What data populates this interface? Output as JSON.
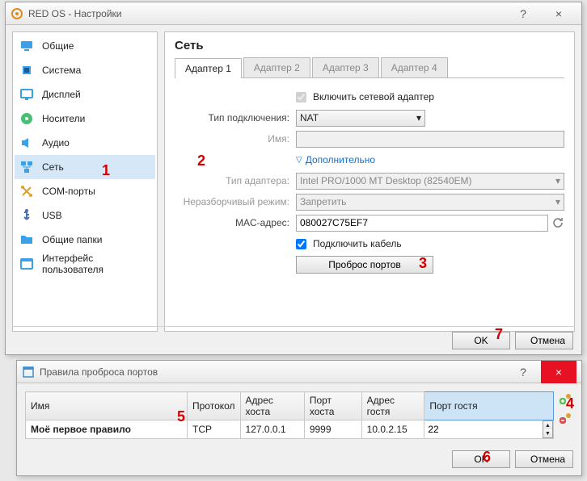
{
  "window": {
    "title": "RED OS - Настройки",
    "help": "?",
    "close": "×"
  },
  "sidebar": {
    "items": [
      {
        "label": "Общие",
        "icon": "monitor",
        "color": "#3aa0e8"
      },
      {
        "label": "Система",
        "icon": "chip",
        "color": "#3aa0e8"
      },
      {
        "label": "Дисплей",
        "icon": "display",
        "color": "#3aa0e8"
      },
      {
        "label": "Носители",
        "icon": "disk",
        "color": "#49bf74"
      },
      {
        "label": "Аудио",
        "icon": "audio",
        "color": "#3aa0e8"
      },
      {
        "label": "Сеть",
        "icon": "net",
        "color": "#3aa0e8",
        "selected": true
      },
      {
        "label": "COM-порты",
        "icon": "serial",
        "color": "#e0a030"
      },
      {
        "label": "USB",
        "icon": "usb",
        "color": "#4a6fb8"
      },
      {
        "label": "Общие папки",
        "icon": "folder",
        "color": "#3aa0e8"
      },
      {
        "label": "Интерфейс пользователя",
        "icon": "ui",
        "color": "#3aa0e8"
      }
    ]
  },
  "content": {
    "title": "Сеть",
    "tabs": [
      "Адаптер 1",
      "Адаптер 2",
      "Адаптер 3",
      "Адаптер 4"
    ],
    "enable_label": "Включить сетевой адаптер",
    "conn_type_label": "Тип подключения:",
    "conn_type_value": "NAT",
    "name_label": "Имя:",
    "name_value": "",
    "advanced_label": "Дополнительно",
    "adapter_type_label": "Тип адаптера:",
    "adapter_type_value": "Intel PRO/1000 MT Desktop (82540EM)",
    "promisc_label": "Неразборчивый режим:",
    "promisc_value": "Запретить",
    "mac_label": "MAC-адрес:",
    "mac_value": "080027C75EF7",
    "cable_label": "Подключить кабель",
    "port_button": "Проброс портов",
    "ok": "OK",
    "cancel": "Отмена"
  },
  "rules": {
    "title": "Правила проброса портов",
    "help": "?",
    "columns": [
      "Имя",
      "Протокол",
      "Адрес хоста",
      "Порт хоста",
      "Адрес гостя",
      "Порт гостя"
    ],
    "row": {
      "name": "Моё первое правило",
      "protocol": "TCP",
      "host_ip": "127.0.0.1",
      "host_port": "9999",
      "guest_ip": "10.0.2.15",
      "guest_port": "22"
    },
    "ok": "OK",
    "cancel": "Отмена"
  },
  "markers": {
    "m1": "1",
    "m2": "2",
    "m3": "3",
    "m4": "4",
    "m5": "5",
    "m6": "6",
    "m7": "7"
  }
}
